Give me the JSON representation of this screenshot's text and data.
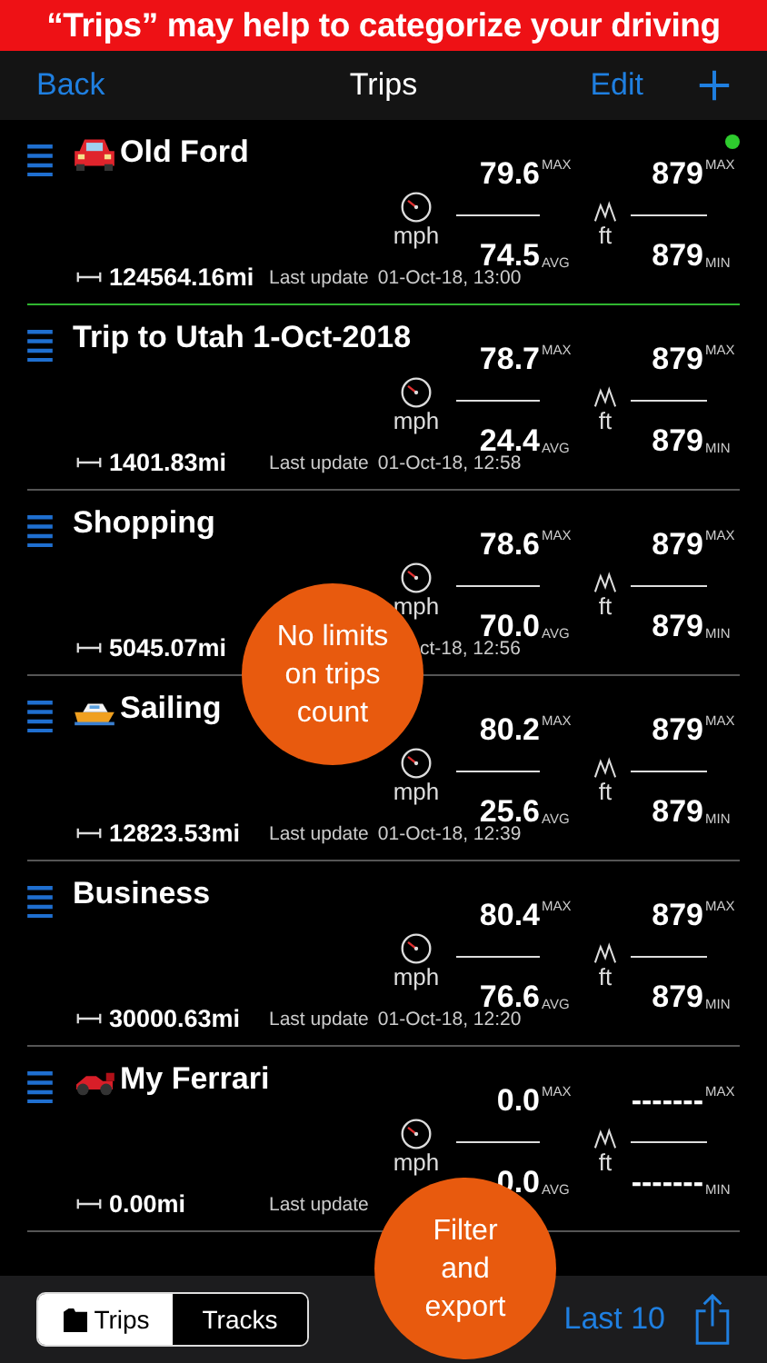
{
  "banner": "“Trips” may help to categorize your driving",
  "nav": {
    "back": "Back",
    "title": "Trips",
    "edit": "Edit"
  },
  "trips": [
    {
      "title": "Old Ford",
      "kind": "car",
      "active": true,
      "speed": {
        "max": "79.6",
        "max_label": "MAX",
        "avg": "74.5",
        "avg_label": "AVG",
        "unit": "mph"
      },
      "altitude": {
        "max": "879",
        "max_label": "MAX",
        "min": "879",
        "min_label": "MIN",
        "unit": "ft"
      },
      "distance": "124564.16mi",
      "update_label": "Last update",
      "update_time": "01-Oct-18, 13:00"
    },
    {
      "title": "Trip to Utah 1-Oct-2018",
      "kind": "plain",
      "active": false,
      "speed": {
        "max": "78.7",
        "max_label": "MAX",
        "avg": "24.4",
        "avg_label": "AVG",
        "unit": "mph"
      },
      "altitude": {
        "max": "879",
        "max_label": "MAX",
        "min": "879",
        "min_label": "MIN",
        "unit": "ft"
      },
      "distance": "1401.83mi",
      "update_label": "Last update",
      "update_time": "01-Oct-18, 12:58"
    },
    {
      "title": "Shopping",
      "kind": "plain",
      "active": false,
      "speed": {
        "max": "78.6",
        "max_label": "MAX",
        "avg": "70.0",
        "avg_label": "AVG",
        "unit": "mph"
      },
      "altitude": {
        "max": "879",
        "max_label": "MAX",
        "min": "879",
        "min_label": "MIN",
        "unit": "ft"
      },
      "distance": "5045.07mi",
      "update_time": "ct-18, 12:56"
    },
    {
      "title": "Sailing",
      "kind": "boat",
      "active": false,
      "speed": {
        "max": "80.2",
        "max_label": "MAX",
        "avg": "25.6",
        "avg_label": "AVG",
        "unit": "mph"
      },
      "altitude": {
        "max": "879",
        "max_label": "MAX",
        "min": "879",
        "min_label": "MIN",
        "unit": "ft"
      },
      "distance": "12823.53mi",
      "update_label": "Last update",
      "update_time": "01-Oct-18, 12:39"
    },
    {
      "title": "Business",
      "kind": "plain",
      "active": false,
      "speed": {
        "max": "80.4",
        "max_label": "MAX",
        "avg": "76.6",
        "avg_label": "AVG",
        "unit": "mph"
      },
      "altitude": {
        "max": "879",
        "max_label": "MAX",
        "min": "879",
        "min_label": "MIN",
        "unit": "ft"
      },
      "distance": "30000.63mi",
      "update_label": "Last update",
      "update_time": "01-Oct-18, 12:20"
    },
    {
      "title": "My Ferrari",
      "kind": "racecar",
      "active": false,
      "speed": {
        "max": "0.0",
        "max_label": "MAX",
        "avg": "0.0",
        "avg_label": "AVG",
        "unit": "mph"
      },
      "altitude": {
        "max": "-------",
        "max_label": "MAX",
        "min": "-------",
        "min_label": "MIN",
        "unit": "ft"
      },
      "distance": "0.00mi",
      "update_label": "Last update"
    }
  ],
  "callouts": [
    {
      "text": "No limits on trips count"
    },
    {
      "text": "Filter and export"
    }
  ],
  "toolbar": {
    "segments": [
      {
        "label": "Trips",
        "selected": true
      },
      {
        "label": "Tracks",
        "selected": false
      }
    ],
    "filter": "Last 10"
  }
}
